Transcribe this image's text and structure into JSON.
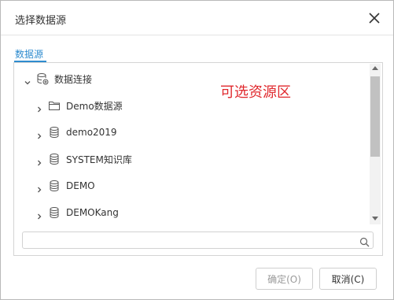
{
  "dialog": {
    "title": "选择数据源"
  },
  "tabs": [
    {
      "label": "数据源",
      "active": true
    }
  ],
  "tree": {
    "root": {
      "label": "数据连接",
      "expanded": true,
      "icon": "database-connection-icon"
    },
    "children": [
      {
        "label": "Demo数据源",
        "icon": "folder-icon"
      },
      {
        "label": "demo2019",
        "icon": "database-icon"
      },
      {
        "label": "SYSTEM知识库",
        "icon": "database-icon"
      },
      {
        "label": "DEMO",
        "icon": "database-icon"
      },
      {
        "label": "DEMOKang",
        "icon": "database-icon"
      }
    ]
  },
  "annotation": "可选资源区",
  "search": {
    "placeholder": "",
    "value": ""
  },
  "buttons": {
    "ok": "确定(O)",
    "cancel": "取消(C)"
  },
  "colors": {
    "accent": "#2f8ccf",
    "annotation": "#e0282d",
    "border": "#d4d4d4"
  }
}
